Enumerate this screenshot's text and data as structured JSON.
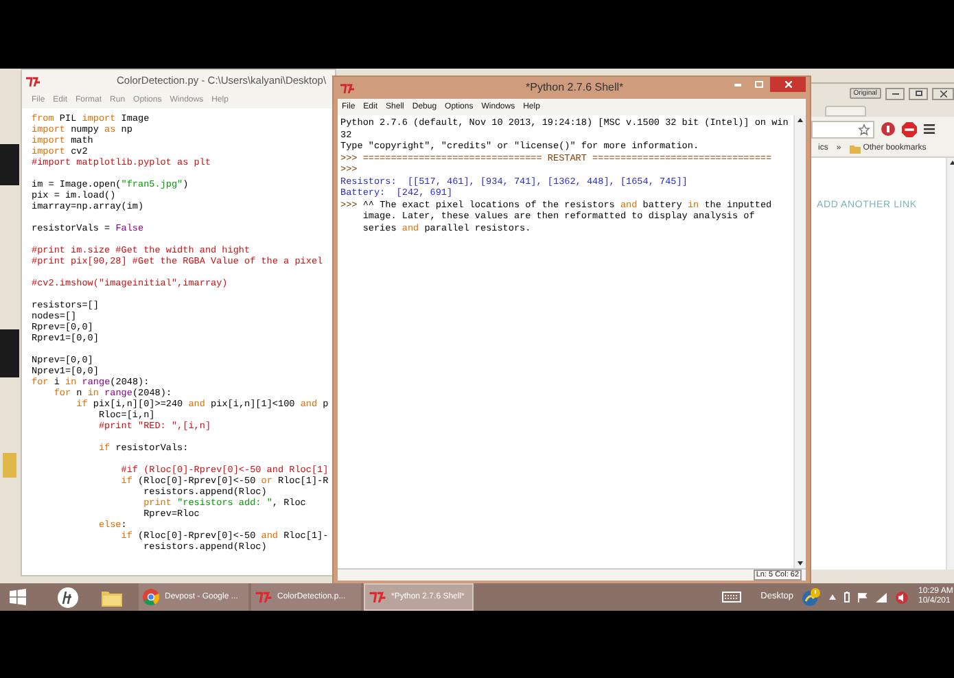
{
  "editor": {
    "title": "ColorDetection.py - C:\\Users\\kalyani\\Desktop\\",
    "menu": [
      "File",
      "Edit",
      "Format",
      "Run",
      "Options",
      "Windows",
      "Help"
    ],
    "blocks": [
      {
        "lines": [
          {
            "segments": [
              {
                "text": "from ",
                "kind": "keyword"
              },
              {
                "text": "PIL ",
                "kind": "plain"
              },
              {
                "text": "import ",
                "kind": "keyword"
              },
              {
                "text": "Image",
                "kind": "plain"
              }
            ]
          },
          {
            "segments": [
              {
                "text": "import ",
                "kind": "keyword"
              },
              {
                "text": "numpy ",
                "kind": "plain"
              },
              {
                "text": "as ",
                "kind": "keyword"
              },
              {
                "text": "np",
                "kind": "plain"
              }
            ]
          },
          {
            "segments": [
              {
                "text": "import ",
                "kind": "keyword"
              },
              {
                "text": "math",
                "kind": "plain"
              }
            ]
          },
          {
            "segments": [
              {
                "text": "import ",
                "kind": "keyword"
              },
              {
                "text": "cv2",
                "kind": "plain"
              }
            ]
          },
          {
            "segments": [
              {
                "text": "#import matplotlib.pyplot as plt",
                "kind": "comment"
              }
            ]
          }
        ]
      },
      {
        "lines": [
          {
            "segments": [
              {
                "text": "im = Image.open(",
                "kind": "plain"
              },
              {
                "text": "\"fran5.jpg\"",
                "kind": "string"
              },
              {
                "text": ")",
                "kind": "plain"
              }
            ]
          },
          {
            "segments": [
              {
                "text": "pix = im.load()",
                "kind": "plain"
              }
            ]
          },
          {
            "segments": [
              {
                "text": "imarray=np.array(im)",
                "kind": "plain"
              }
            ]
          }
        ]
      },
      {
        "lines": [
          {
            "segments": [
              {
                "text": "resistorVals = ",
                "kind": "plain"
              },
              {
                "text": "False",
                "kind": "builtin"
              }
            ]
          }
        ]
      },
      {
        "lines": [
          {
            "segments": [
              {
                "text": "#print im.size #Get the width and hight",
                "kind": "comment"
              }
            ]
          },
          {
            "segments": [
              {
                "text": "#print pix[90,28] #Get the RGBA Value of the a pixel",
                "kind": "comment"
              }
            ]
          }
        ]
      },
      {
        "lines": [
          {
            "segments": [
              {
                "text": "#cv2.imshow(\"imageinitial\",imarray)",
                "kind": "comment"
              }
            ]
          }
        ]
      },
      {
        "lines": [
          {
            "segments": [
              {
                "text": "resistors=[]",
                "kind": "plain"
              }
            ]
          },
          {
            "segments": [
              {
                "text": "nodes=[]",
                "kind": "plain"
              }
            ]
          },
          {
            "segments": [
              {
                "text": "Rprev=[0,0]",
                "kind": "plain"
              }
            ]
          },
          {
            "segments": [
              {
                "text": "Rprev1=[0,0]",
                "kind": "plain"
              }
            ]
          }
        ]
      },
      {
        "lines": [
          {
            "segments": [
              {
                "text": "Nprev=[0,0]",
                "kind": "plain"
              }
            ]
          },
          {
            "segments": [
              {
                "text": "Nprev1=[0,0]",
                "kind": "plain"
              }
            ]
          },
          {
            "segments": [
              {
                "text": "for ",
                "kind": "keyword"
              },
              {
                "text": "i ",
                "kind": "plain"
              },
              {
                "text": "in ",
                "kind": "keyword"
              },
              {
                "text": "range",
                "kind": "builtin"
              },
              {
                "text": "(2048):",
                "kind": "plain"
              }
            ]
          },
          {
            "segments": [
              {
                "text": "    for ",
                "kind": "keyword"
              },
              {
                "text": "n ",
                "kind": "plain"
              },
              {
                "text": "in ",
                "kind": "keyword"
              },
              {
                "text": "range",
                "kind": "builtin"
              },
              {
                "text": "(2048):",
                "kind": "plain"
              }
            ]
          },
          {
            "segments": [
              {
                "text": "        if ",
                "kind": "keyword"
              },
              {
                "text": "pix[i,n][0]>=240 ",
                "kind": "plain"
              },
              {
                "text": "and ",
                "kind": "keyword"
              },
              {
                "text": "pix[i,n][1]<100 ",
                "kind": "plain"
              },
              {
                "text": "and ",
                "kind": "keyword"
              },
              {
                "text": "p",
                "kind": "plain"
              }
            ]
          },
          {
            "segments": [
              {
                "text": "            Rloc=[i,n]",
                "kind": "plain"
              }
            ]
          },
          {
            "segments": [
              {
                "text": "            #print \"RED: \",[i,n]",
                "kind": "comment"
              }
            ]
          }
        ]
      },
      {
        "lines": [
          {
            "segments": [
              {
                "text": "            if ",
                "kind": "keyword"
              },
              {
                "text": "resistorVals:",
                "kind": "plain"
              }
            ]
          }
        ]
      },
      {
        "lines": [
          {
            "segments": [
              {
                "text": "                #if (Rloc[0]-Rprev[0]<-50 and Rloc[1]",
                "kind": "comment"
              }
            ]
          },
          {
            "segments": [
              {
                "text": "                if ",
                "kind": "keyword"
              },
              {
                "text": "(Rloc[0]-Rprev[0]<-50 ",
                "kind": "plain"
              },
              {
                "text": "or ",
                "kind": "keyword"
              },
              {
                "text": "Rloc[1]-R",
                "kind": "plain"
              }
            ]
          },
          {
            "segments": [
              {
                "text": "                    resistors.append(Rloc)",
                "kind": "plain"
              }
            ]
          },
          {
            "segments": [
              {
                "text": "                    print ",
                "kind": "keyword"
              },
              {
                "text": "\"resistors add: \"",
                "kind": "string"
              },
              {
                "text": ", Rloc",
                "kind": "plain"
              }
            ]
          },
          {
            "segments": [
              {
                "text": "                    Rprev=Rloc",
                "kind": "plain"
              }
            ]
          },
          {
            "segments": [
              {
                "text": "            else",
                "kind": "keyword"
              },
              {
                "text": ":",
                "kind": "plain"
              }
            ]
          },
          {
            "segments": [
              {
                "text": "                if ",
                "kind": "keyword"
              },
              {
                "text": "(Rloc[0]-Rprev[0]<-50 ",
                "kind": "plain"
              },
              {
                "text": "and ",
                "kind": "keyword"
              },
              {
                "text": "Rloc[1]-",
                "kind": "plain"
              }
            ]
          },
          {
            "segments": [
              {
                "text": "                    resistors.append(Rloc)",
                "kind": "plain"
              }
            ]
          }
        ]
      }
    ]
  },
  "shell": {
    "title": "*Python 2.7.6 Shell*",
    "menu": [
      "File",
      "Edit",
      "Shell",
      "Debug",
      "Options",
      "Windows",
      "Help"
    ],
    "lines": [
      {
        "segments": [
          {
            "text": "Python 2.7.6 (default, Nov 10 2013, 19:24:18) [MSC v.1500 32 bit (Intel)] on win",
            "kind": "plain"
          }
        ]
      },
      {
        "segments": [
          {
            "text": "32",
            "kind": "plain"
          }
        ]
      },
      {
        "segments": [
          {
            "text": "Type \"copyright\", \"credits\" or \"license()\" for more information.",
            "kind": "plain"
          }
        ]
      },
      {
        "segments": [
          {
            "text": ">>> ================================ RESTART ================================",
            "kind": "prompt"
          }
        ]
      },
      {
        "segments": [
          {
            "text": ">>>",
            "kind": "prompt"
          }
        ]
      },
      {
        "segments": [
          {
            "text": "Resistors:  [[517, 461], [934, 741], [1362, 448], [1654, 745]]",
            "kind": "output"
          }
        ]
      },
      {
        "segments": [
          {
            "text": "Battery:  [242, 691]",
            "kind": "output"
          }
        ]
      },
      {
        "segments": [
          {
            "text": ">>>",
            "kind": "prompt"
          },
          {
            "text": " ^^ The exact pixel locations of the resistors ",
            "kind": "plain"
          },
          {
            "text": "and ",
            "kind": "keyword"
          },
          {
            "text": "battery ",
            "kind": "plain"
          },
          {
            "text": "in ",
            "kind": "keyword"
          },
          {
            "text": "the inputted",
            "kind": "plain"
          }
        ]
      },
      {
        "segments": [
          {
            "text": "    image. Later, these values are then reformatted to display analysis of",
            "kind": "plain"
          }
        ]
      },
      {
        "segments": [
          {
            "text": "    series ",
            "kind": "plain"
          },
          {
            "text": "and ",
            "kind": "keyword"
          },
          {
            "text": "parallel resistors.",
            "kind": "plain"
          }
        ]
      }
    ],
    "status": "Ln: 5 Col: 62"
  },
  "browser": {
    "button": "Original",
    "bookmark": "ics",
    "chevron": "»",
    "folder": "Other bookmarks",
    "link": "ADD ANOTHER LINK"
  },
  "taskbar": {
    "buttons": [
      {
        "label": "Devpost - Google ...",
        "kind": "browser",
        "selected": false
      },
      {
        "label": "ColorDetection.p...",
        "kind": "idle",
        "selected": false
      },
      {
        "label": "*Python 2.7.6 Shell*",
        "kind": "idle",
        "selected": true
      }
    ],
    "desktop": "Desktop",
    "time": "10:29 AM",
    "date": "10/4/201"
  }
}
